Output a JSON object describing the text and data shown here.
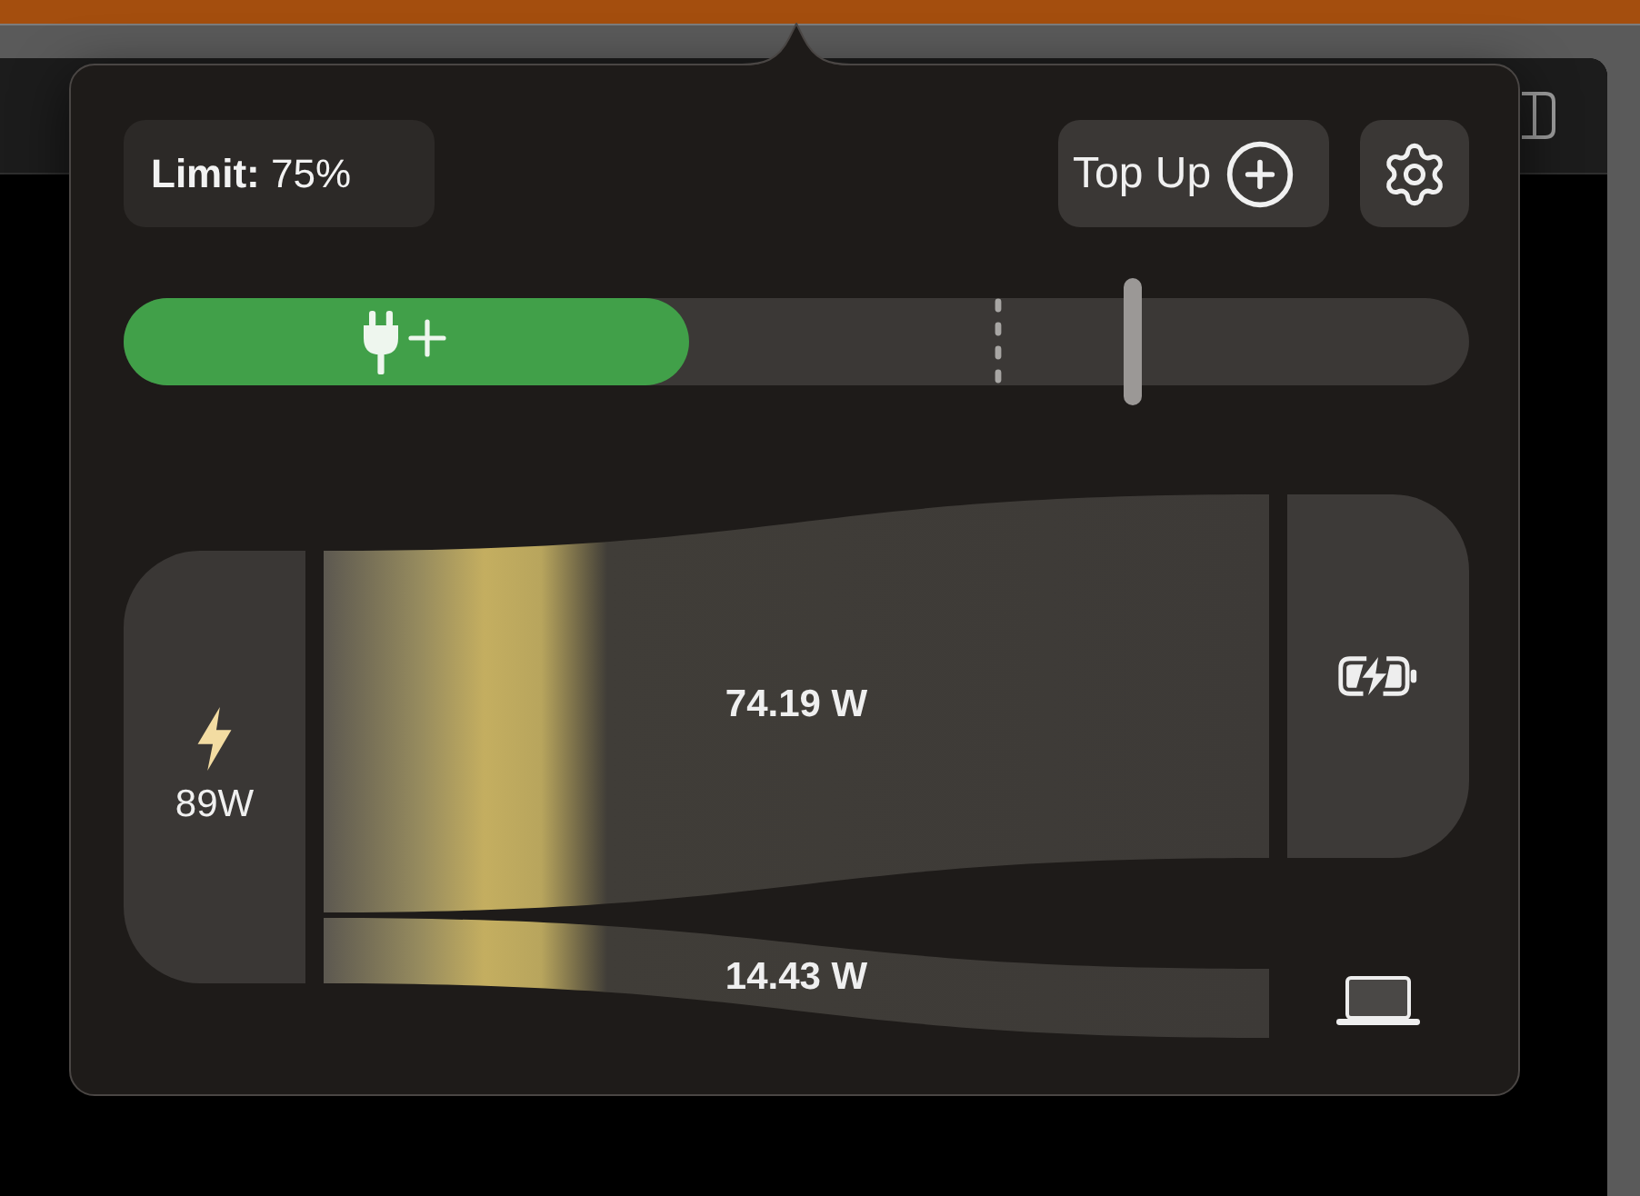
{
  "limit": "**Limit:** 75%",
  "header_buttons": [
    {
      "kind": "top_up",
      "label": "Top Up"
    },
    {
      "kind": "settings"
    }
  ],
  "charge_bar": {
    "fill": {
      "level": 0.42
    },
    "marker": {
      "level": 0.65
    },
    "limit_handle": {
      "level": 0.75
    }
  },
  "power_flow": {
    "source": {
      "label": "89W"
    },
    "flows": [
      {
        "kind": "battery",
        "label": "74.19 W"
      },
      {
        "kind": "system",
        "label": "14.43 W"
      }
    ]
  }
}
